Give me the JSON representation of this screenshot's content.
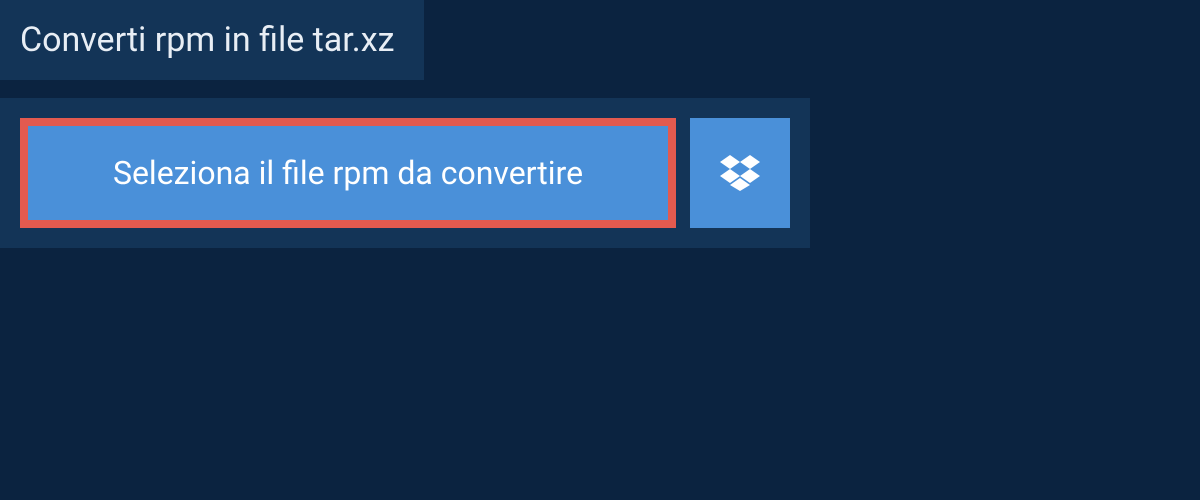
{
  "header": {
    "title": "Converti rpm in file tar.xz"
  },
  "upload": {
    "select_label": "Seleziona il file rpm da convertire",
    "dropbox_icon": "dropbox-icon"
  },
  "colors": {
    "background_dark": "#0b2340",
    "panel": "#133457",
    "button": "#4a90d9",
    "highlight_border": "#e35a4f",
    "text_light": "#e8eef5"
  }
}
